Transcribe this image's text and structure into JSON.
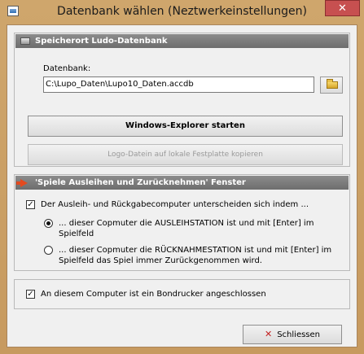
{
  "window": {
    "title": "Datenbank wählen (Neztwerkeinstellungen)",
    "close_glyph": "✕"
  },
  "storage": {
    "header": "Speicherort Ludo-Datenbank",
    "db_label": "Datenbank:",
    "db_path": "C:\\Lupo_Daten\\Lupo10_Daten.accdb",
    "explorer_button": "Windows-Explorer starten",
    "copy_logos_button": "Logo-Datein auf lokale Festplatte kopieren"
  },
  "lending": {
    "header": "'Spiele Ausleihen und Zurücknehmen' Fenster",
    "distinguish_label": "Der Ausleih- und Rückgabecomputer unterscheiden sich indem ...",
    "distinguish_checked": true,
    "option1_line1": "... dieser Copmuter die AUSLEIHSTATION ist und mit [Enter] im",
    "option1_line2": "Spielfeld",
    "option1_selected": true,
    "option2_line1": "... dieser Copmuter die RÜCKNAHMESTATION ist und mit [Enter] im",
    "option2_line2": "Spielfeld das Spiel immer Zurückgenommen wird.",
    "option2_selected": false
  },
  "printer": {
    "label": "An diesem Computer ist ein Bondrucker angeschlossen",
    "checked": true
  },
  "footer": {
    "close_label": "Schliessen",
    "close_icon": "✕"
  },
  "colors": {
    "frame": "#c9a06a",
    "close_red": "#c75050",
    "header_gray": "#7a7a7a",
    "arrow_orange": "#e34a1f"
  }
}
